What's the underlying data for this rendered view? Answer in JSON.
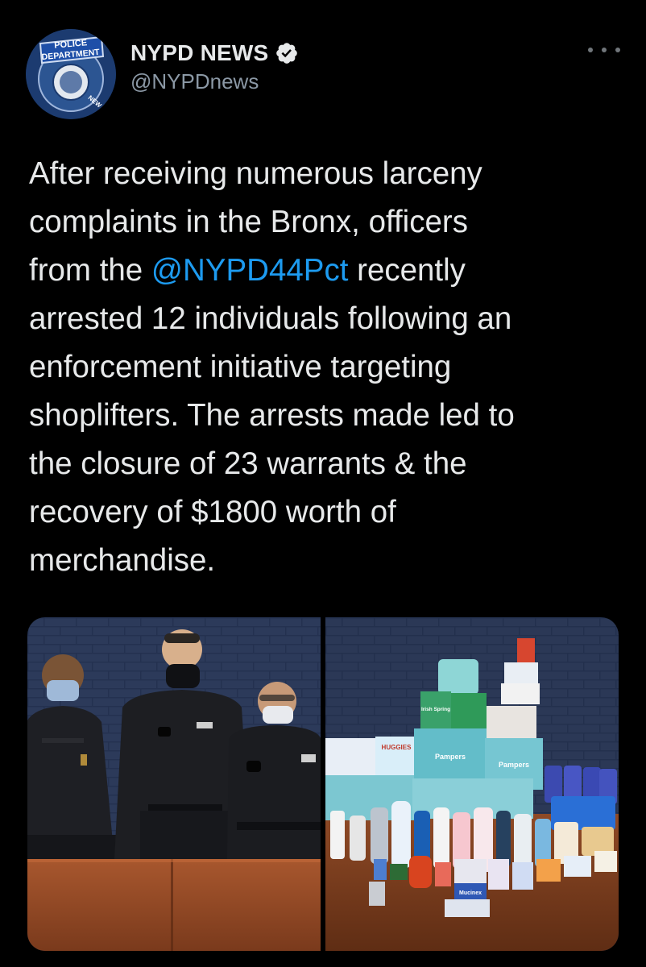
{
  "author": {
    "display_name": "NYPD NEWS",
    "handle": "@NYPDnews",
    "verified": true,
    "avatar_badge_text": [
      "POLICE",
      "DEPARTMENT",
      "NEW"
    ]
  },
  "tweet": {
    "text_lines": [
      [
        {
          "t": "After receiving numerous larceny"
        }
      ],
      [
        {
          "t": "complaints in the Bronx, officers"
        }
      ],
      [
        {
          "t": "from the "
        },
        {
          "t": "@NYPD44Pct",
          "mention": true
        },
        {
          "t": " recently"
        }
      ],
      [
        {
          "t": "arrested 12 individuals following an"
        }
      ],
      [
        {
          "t": "enforcement initiative targeting"
        }
      ],
      [
        {
          "t": "shoplifters. The arrests made led to"
        }
      ],
      [
        {
          "t": "the closure of 23 warrants & the"
        }
      ],
      [
        {
          "t": "recovery of $1800 worth of"
        }
      ],
      [
        {
          "t": "merchandise."
        }
      ]
    ]
  },
  "media": [
    {
      "kind": "photo",
      "subject": "officers-photo"
    },
    {
      "kind": "photo",
      "subject": "merchandise-photo",
      "visible_labels": [
        "HUGGIES",
        "Pampers",
        "Pampers",
        "Irish Spring",
        "Mucinex"
      ]
    }
  ],
  "colors": {
    "background": "#000000",
    "text": "#e7e9ea",
    "secondary": "#8b98a5",
    "accent": "#1d9bf0"
  },
  "icons": {
    "verified": "verified-badge-icon",
    "more": "more-options-icon"
  }
}
